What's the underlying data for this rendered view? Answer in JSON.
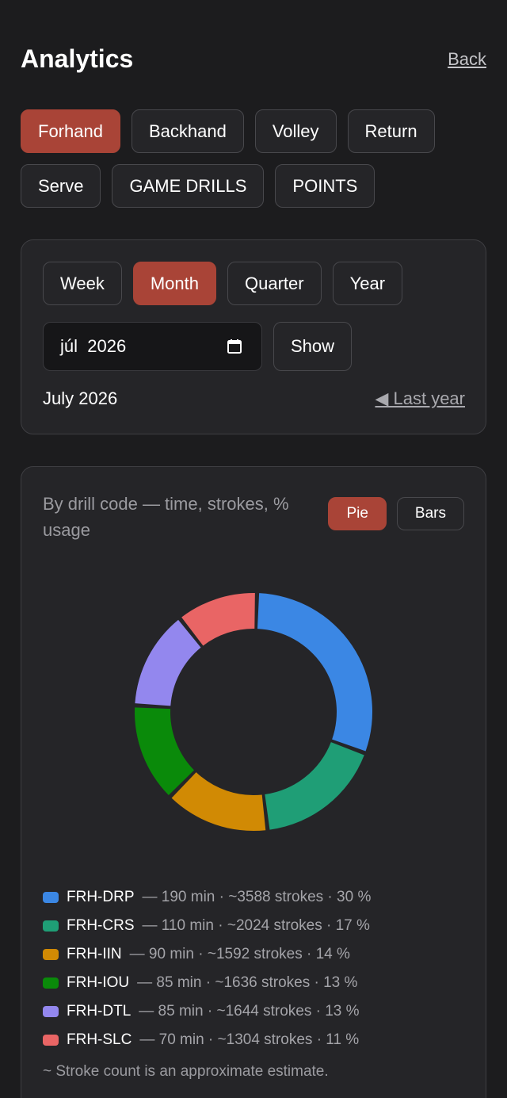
{
  "header": {
    "title": "Analytics",
    "back": "Back"
  },
  "strokes": [
    {
      "label": "Forhand",
      "active": true
    },
    {
      "label": "Backhand",
      "active": false
    },
    {
      "label": "Volley",
      "active": false
    },
    {
      "label": "Return",
      "active": false
    },
    {
      "label": "Serve",
      "active": false
    },
    {
      "label": "GAME DRILLS",
      "active": false
    },
    {
      "label": "POINTS",
      "active": false
    }
  ],
  "period": {
    "options": [
      {
        "label": "Week",
        "active": false
      },
      {
        "label": "Month",
        "active": true
      },
      {
        "label": "Quarter",
        "active": false
      },
      {
        "label": "Year",
        "active": false
      }
    ],
    "date_value": "júl  2026",
    "show_label": "Show",
    "current_label": "July 2026",
    "last_year_label": "◀ Last year"
  },
  "chart_card": {
    "title": "By drill code — time, strokes, % usage",
    "pie_label": "Pie",
    "bars_label": "Bars",
    "footnote": "~ Stroke count is an approximate estimate."
  },
  "chart_data": {
    "type": "pie",
    "donut": true,
    "categories": [
      "FRH-DRP",
      "FRH-CRS",
      "FRH-IIN",
      "FRH-IOU",
      "FRH-DTL",
      "FRH-SLC"
    ],
    "minutes": [
      190,
      110,
      90,
      85,
      85,
      70
    ],
    "strokes": [
      3588,
      2024,
      1592,
      1636,
      1644,
      1304
    ],
    "percent": [
      30,
      17,
      14,
      13,
      13,
      11
    ],
    "colors": [
      "#3b87e4",
      "#1f9e76",
      "#d18a04",
      "#0a8a0a",
      "#9387ee",
      "#e96565"
    ],
    "legend": [
      {
        "code": "FRH-DRP",
        "stats": "— 190 min · ~3588 strokes · 30 %"
      },
      {
        "code": "FRH-CRS",
        "stats": "— 110 min · ~2024 strokes · 17 %"
      },
      {
        "code": "FRH-IIN",
        "stats": "— 90 min · ~1592 strokes · 14 %"
      },
      {
        "code": "FRH-IOU",
        "stats": "— 85 min · ~1636 strokes · 13 %"
      },
      {
        "code": "FRH-DTL",
        "stats": "— 85 min · ~1644 strokes · 13 %"
      },
      {
        "code": "FRH-SLC",
        "stats": "— 70 min · ~1304 strokes · 11 %"
      }
    ]
  }
}
